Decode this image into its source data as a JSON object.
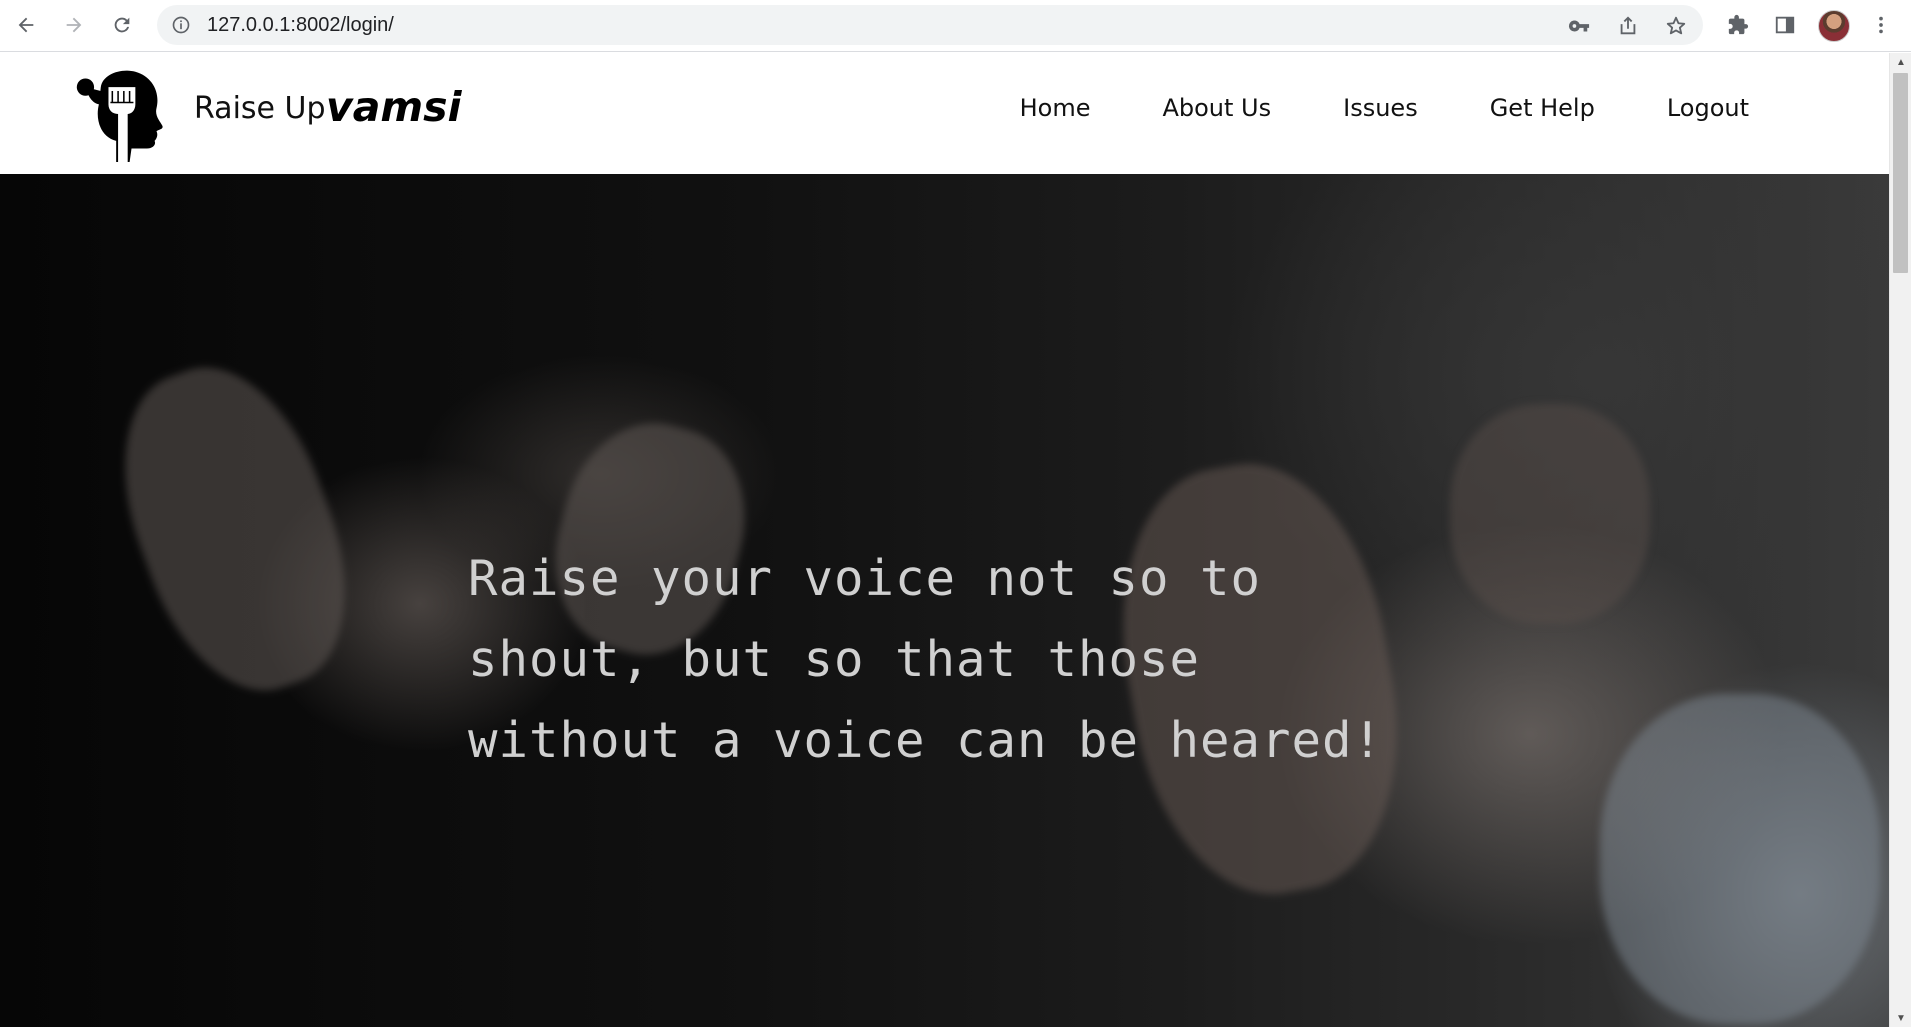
{
  "browser": {
    "url": "127.0.0.1:8002/login/",
    "icons": {
      "back": "arrow-left-icon",
      "forward": "arrow-right-icon",
      "reload": "reload-icon",
      "site_info": "info-icon",
      "password": "key-icon",
      "share": "share-icon",
      "bookmark": "star-icon",
      "extensions": "puzzle-icon",
      "side_panel": "side-panel-icon",
      "profile": "avatar",
      "menu": "kebab-menu-icon"
    }
  },
  "header": {
    "brand": "Raise Up",
    "username": "vamsi",
    "logo_icon": "raised-fist-head-logo",
    "nav": [
      {
        "label": "Home"
      },
      {
        "label": "About Us"
      },
      {
        "label": "Issues"
      },
      {
        "label": "Get Help"
      },
      {
        "label": "Logout"
      }
    ]
  },
  "hero": {
    "quote_lines": [
      "Raise your voice not so to",
      "shout, but so that those",
      "without a voice can be heared!"
    ]
  },
  "colors": {
    "header_bg": "#ffffff",
    "nav_text": "#111111",
    "quote_text": "#d0d0d0",
    "hero_bg": "#111111"
  }
}
